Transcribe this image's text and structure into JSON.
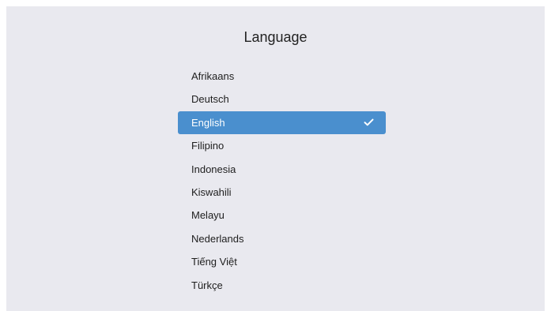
{
  "page": {
    "title": "Language"
  },
  "languages": [
    {
      "label": "Afrikaans",
      "selected": false
    },
    {
      "label": "Deutsch",
      "selected": false
    },
    {
      "label": "English",
      "selected": true
    },
    {
      "label": "Filipino",
      "selected": false
    },
    {
      "label": "Indonesia",
      "selected": false
    },
    {
      "label": "Kiswahili",
      "selected": false
    },
    {
      "label": "Melayu",
      "selected": false
    },
    {
      "label": "Nederlands",
      "selected": false
    },
    {
      "label": "Tiếng Việt",
      "selected": false
    },
    {
      "label": "Türkçe",
      "selected": false
    }
  ],
  "colors": {
    "background": "#e9e9ef",
    "selection": "#4a8fce",
    "text": "#1e1e1e",
    "selected_text": "#ffffff"
  },
  "icons": {
    "selected_marker": "checkmark-icon"
  }
}
